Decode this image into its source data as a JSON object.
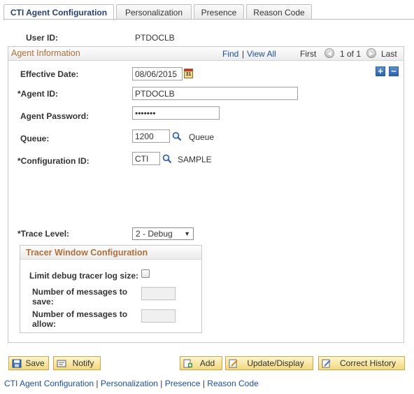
{
  "tabs": [
    {
      "label": "CTI Agent Configuration",
      "active": true
    },
    {
      "label": "Personalization",
      "active": false
    },
    {
      "label": "Presence",
      "active": false
    },
    {
      "label": "Reason Code",
      "active": false
    }
  ],
  "user_id": {
    "label": "User ID:",
    "value": "PTDOCLB"
  },
  "agent_info": {
    "title": "Agent Information",
    "find": "Find",
    "separator": "|",
    "view_all": "View All",
    "first": "First",
    "page": "1 of 1",
    "last": "Last"
  },
  "fields": {
    "effective_date": {
      "label": "Effective Date:",
      "value": "08/06/2015"
    },
    "agent_id": {
      "label": "*Agent ID:",
      "value": "PTDOCLB"
    },
    "agent_password": {
      "label": "Agent Password:",
      "value": "•••••••"
    },
    "queue": {
      "label": "Queue:",
      "value": "1200",
      "description": "Queue"
    },
    "configuration_id": {
      "label": "*Configuration ID:",
      "value": "CTI",
      "description": "SAMPLE"
    },
    "trace_level": {
      "label": "*Trace Level:",
      "value": "2 - Debug"
    }
  },
  "calendar_icon_text": "31",
  "tracer": {
    "title": "Tracer Window Configuration",
    "limit_label": "Limit debug tracer log size:",
    "limit_checked": false,
    "save_label_1": "Number of messages to",
    "save_label_2": "save:",
    "allow_label_1": "Number of messages to",
    "allow_label_2": "allow:",
    "save_value": "",
    "allow_value": ""
  },
  "buttons": {
    "save": "Save",
    "notify": "Notify",
    "add": "Add",
    "update_display": "Update/Display",
    "correct_history": "Correct History"
  },
  "footer_links": [
    "CTI Agent Configuration",
    "Personalization",
    "Presence",
    "Reason Code"
  ],
  "footer_separator": "|",
  "colors": {
    "link": "#1a4f9c",
    "group_title": "#b0703a",
    "button_bg": "#f2d77e"
  }
}
